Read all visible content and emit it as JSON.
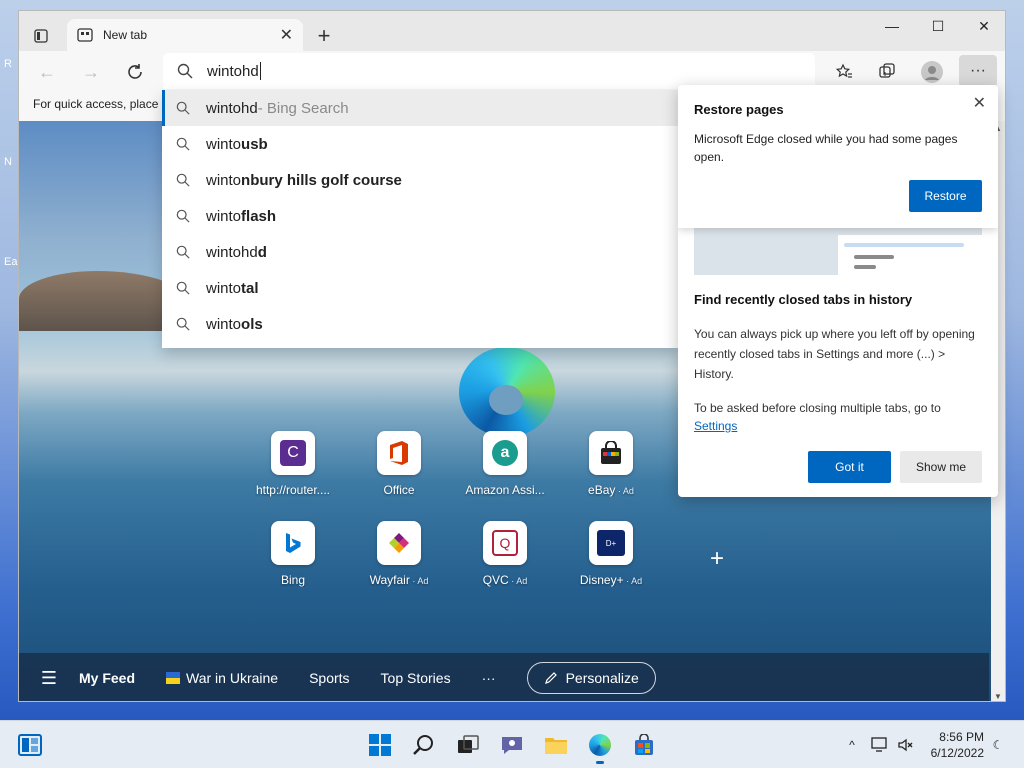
{
  "desktop": {
    "icon_labels": [
      "R",
      "N",
      "Ea"
    ]
  },
  "browser": {
    "tab": {
      "title": "New tab"
    },
    "address": {
      "typed": "wintohd"
    },
    "favorites_bar": {
      "text": "For quick access, place y"
    }
  },
  "suggestions": [
    {
      "typed": "wintohd",
      "rest": "",
      "suffix": " - Bing Search",
      "icon": "search-icon"
    },
    {
      "typed": "winto",
      "rest": "usb",
      "suffix": "",
      "icon": "search-icon"
    },
    {
      "typed": "winto",
      "rest": "nbury hills golf course",
      "suffix": "",
      "icon": "search-icon"
    },
    {
      "typed": "winto",
      "rest": "flash",
      "suffix": "",
      "icon": "search-icon"
    },
    {
      "typed": "wintohd",
      "rest": "d",
      "suffix": "",
      "icon": "search-icon"
    },
    {
      "typed": "winto",
      "rest": "tal",
      "suffix": "",
      "icon": "search-icon"
    },
    {
      "typed": "winto",
      "rest": "ols",
      "suffix": "",
      "icon": "search-icon"
    }
  ],
  "restore_card": {
    "title": "Restore pages",
    "body": "Microsoft Edge closed while you had some pages open.",
    "button": "Restore"
  },
  "history_tip": {
    "title": "Find recently closed tabs in history",
    "body": "You can always pick up where you left off by opening recently closed tabs in Settings and more (...) > History.",
    "body2": "To be asked before closing multiple tabs, go to",
    "link": "Settings",
    "got_it": "Got it",
    "show_me": "Show me"
  },
  "quick_links": [
    {
      "label": "http://router....",
      "ad": "",
      "icon": "c-letter-icon",
      "color": "#5c2d91"
    },
    {
      "label": "Office",
      "ad": "",
      "icon": "office-icon",
      "color": "#d83b01"
    },
    {
      "label": "Amazon Assi...",
      "ad": "",
      "icon": "amazon-assistant-icon",
      "color": "#1a9c8f"
    },
    {
      "label": "eBay",
      "ad": "Ad",
      "icon": "ebay-bag-icon",
      "color": "#e53238"
    },
    {
      "label": "Bing",
      "ad": "",
      "icon": "bing-icon",
      "color": "#0078d4"
    },
    {
      "label": "Wayfair",
      "ad": "Ad",
      "icon": "wayfair-icon",
      "color": "#7f187f"
    },
    {
      "label": "QVC",
      "ad": "Ad",
      "icon": "qvc-icon",
      "color": "#b0213a"
    },
    {
      "label": "Disney+",
      "ad": "Ad",
      "icon": "disney-plus-icon",
      "color": "#0d2669"
    }
  ],
  "feed_bar": {
    "items": [
      "My Feed",
      "War in Ukraine",
      "Sports",
      "Top Stories"
    ],
    "more": "···",
    "personalize": "Personalize"
  },
  "taskbar": {
    "time": "8:56 PM",
    "date": "6/12/2022"
  }
}
